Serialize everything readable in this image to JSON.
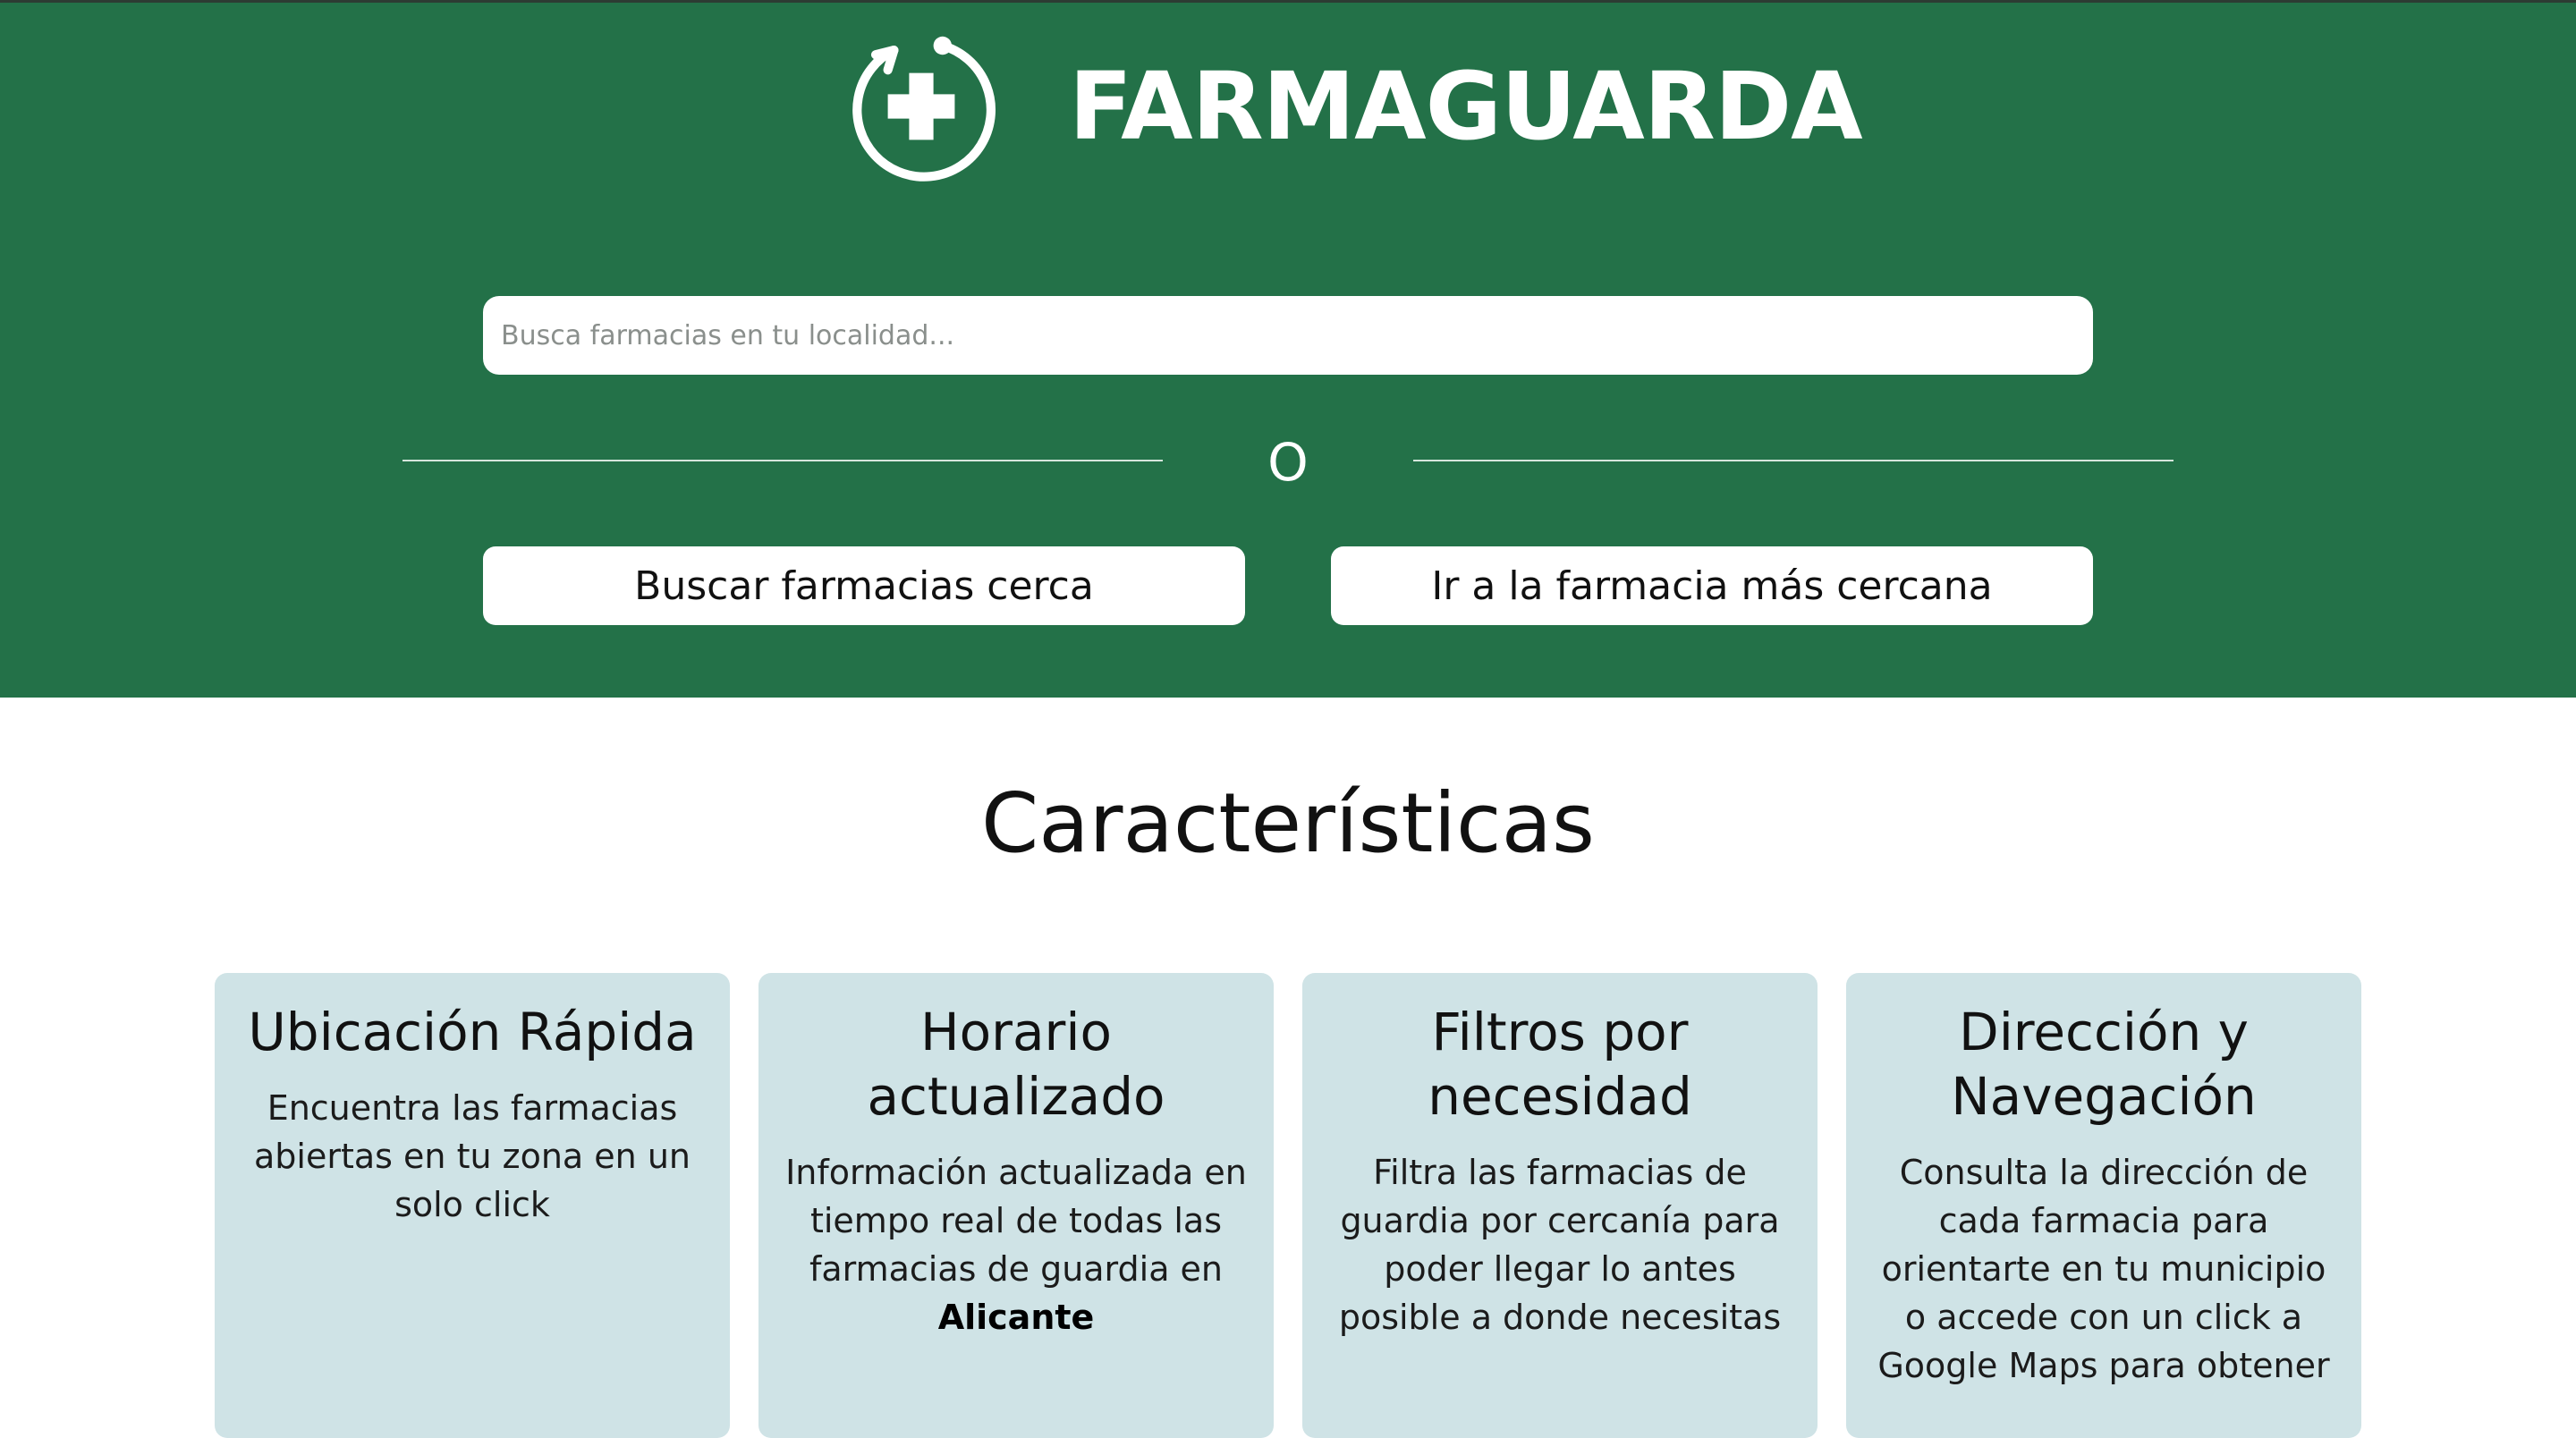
{
  "header": {
    "brand_name": "FARMAGUARDA",
    "logo_icon": "pharmacy-cross-refresh-icon",
    "search": {
      "placeholder": "Busca farmacias en tu localidad...",
      "value": ""
    },
    "divider_text": "O",
    "buttons": {
      "search_nearby": "Buscar farmacias cerca",
      "go_nearest": "Ir a la farmacia más cercana"
    }
  },
  "features": {
    "title": "Características",
    "cards": [
      {
        "title": "Ubicación Rápida",
        "text": "Encuentra las farmacias abiertas en tu zona en un solo click"
      },
      {
        "title": "Horario actualizado",
        "text": "Información actualizada en tiempo real de todas las farmacias de guardia en ",
        "highlight": "Alicante"
      },
      {
        "title": "Filtros por necesidad",
        "text": "Filtra las farmacias de guardia por cercanía para poder llegar lo antes posible a donde necesitas"
      },
      {
        "title": "Dirección y Navegación",
        "text": "Consulta la dirección de cada farmacia para orientarte en tu municipio o accede con un click a Google Maps para obtener"
      }
    ]
  },
  "colors": {
    "brand_green": "#237148",
    "card_background": "#cfe3e6",
    "white": "#ffffff"
  }
}
